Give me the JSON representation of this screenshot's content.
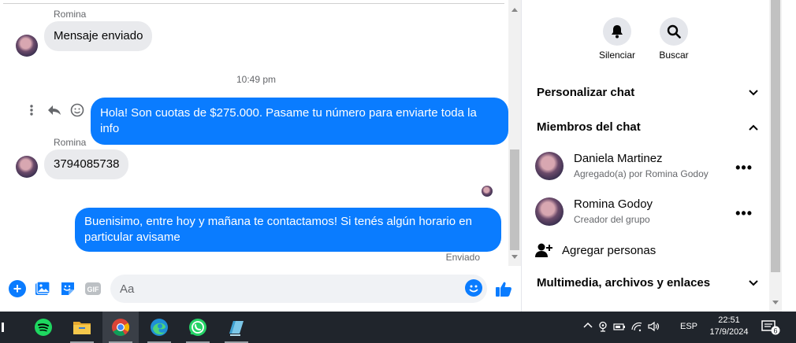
{
  "chat": {
    "messages": [
      {
        "sender": "Romina",
        "text": "Mensaje enviado"
      },
      {
        "timestamp": "10:49 pm"
      },
      {
        "text": "Hola! Son cuotas de $275.000. Pasame tu número para enviarte toda la info"
      },
      {
        "sender": "Romina",
        "text": "3794085738"
      },
      {
        "text": "Buenisimo, entre hoy y mañana te contactamos! Si tenés algún horario en particular avisame"
      }
    ],
    "sent_status": "Enviado"
  },
  "composer": {
    "placeholder": "Aa",
    "icons": [
      "plus-icon",
      "image-icon",
      "sticker-icon",
      "gif-icon",
      "emoji-icon",
      "like-icon"
    ],
    "gif_label": "GIF"
  },
  "panel": {
    "actions": [
      {
        "label": "Silenciar",
        "icon": "bell-icon"
      },
      {
        "label": "Buscar",
        "icon": "search-icon"
      }
    ],
    "sections": {
      "customize": "Personalizar chat",
      "members": "Miembros del chat",
      "media": "Multimedia, archivos y enlaces"
    },
    "members": [
      {
        "name": "Daniela Martinez",
        "subtitle": "Agregado(a) por Romina Godoy"
      },
      {
        "name": "Romina Godoy",
        "subtitle": "Creador del grupo"
      }
    ],
    "add_people": "Agregar personas"
  },
  "taskbar": {
    "apps": [
      "task-view",
      "spotify",
      "file-explorer",
      "chrome",
      "edge",
      "whatsapp",
      "notes"
    ],
    "language": "ESP",
    "time": "22:51",
    "date": "17/9/2024",
    "notification_count": "6"
  },
  "colors": {
    "accent": "#0a7cff",
    "incoming_bubble": "#e9eaed",
    "taskbar": "#20252c"
  }
}
